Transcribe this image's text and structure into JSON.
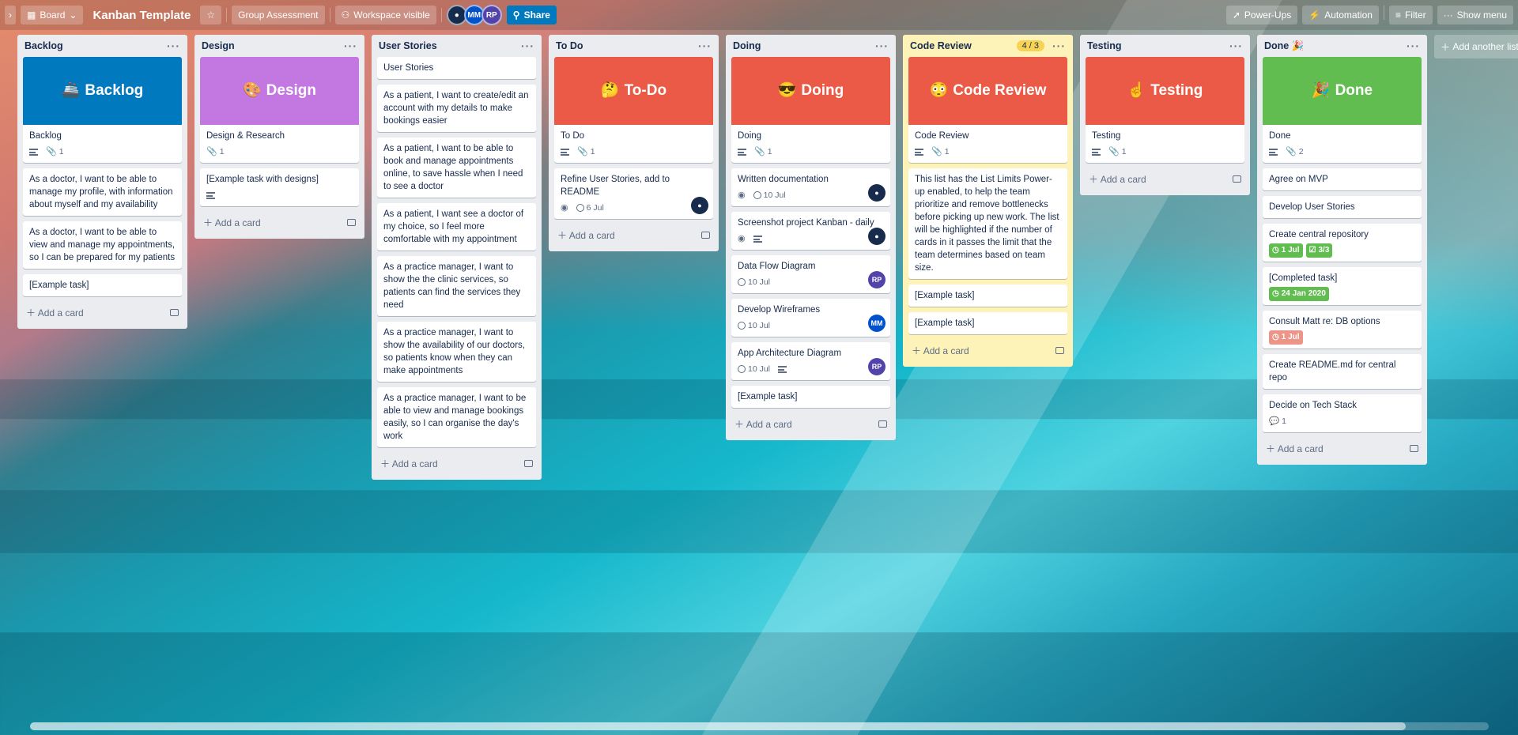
{
  "header": {
    "expand": "›",
    "view": "Board",
    "title": "Kanban Template",
    "group": "Group Assessment",
    "visibility": "Workspace visible",
    "members": [
      {
        "initials": "",
        "color": "#172b4d"
      },
      {
        "initials": "MM",
        "color": "#0052cc"
      },
      {
        "initials": "RP",
        "color": "#5243aa"
      }
    ],
    "share": "Share",
    "powerups": "Power-Ups",
    "automation": "Automation",
    "filter": "Filter",
    "menu": "Show menu"
  },
  "lists": {
    "backlog": {
      "title": "Backlog",
      "cover_title": "Backlog",
      "cover_emoji": "🚢",
      "cover_color": "#0079bf",
      "cards": [
        "Backlog",
        "As a doctor, I want to be able to manage my profile, with information about myself and my availability",
        "As a doctor, I want to be able to view and manage my appointments, so I can be prepared for my patients",
        "[Example task]"
      ],
      "attach": "1"
    },
    "design": {
      "title": "Design",
      "cover_title": "Design",
      "cover_emoji": "🎨",
      "cover_color": "#c377e0",
      "cards": [
        "Design & Research",
        "[Example task with designs]"
      ],
      "attach": "1"
    },
    "stories": {
      "title": "User Stories",
      "cards": [
        "User Stories",
        "As a patient, I want to create/edit an account with my details to make bookings easier",
        "As a patient, I want to be able to book and manage appointments online, to save hassle when I need to see a doctor",
        "As a patient, I want see a doctor of my choice, so I feel more comfortable with my appointment",
        "As a practice manager, I want to show the the clinic services, so patients can find the services they need",
        "As a practice manager, I want to show the availability of our doctors, so patients know when they can make appointments",
        "As a practice manager, I want to be able to view and manage bookings easily, so I can organise the day's work"
      ]
    },
    "todo": {
      "title": "To Do",
      "cover_title": "To-Do",
      "cover_emoji": "🤔",
      "cover_color": "#eb5a46",
      "cards": [
        "To Do",
        "Refine User Stories, add to README"
      ],
      "attach": "1",
      "date": "6 Jul"
    },
    "doing": {
      "title": "Doing",
      "cover_title": "Doing",
      "cover_emoji": "😎",
      "cover_color": "#eb5a46",
      "cards": [
        "Doing",
        "Written documentation",
        "Screenshot project Kanban - daily",
        "Data Flow Diagram",
        "Develop Wireframes",
        "App Architecture Diagram",
        "[Example task]"
      ],
      "attach": "1",
      "date": "10 Jul",
      "mm": "MM",
      "rp": "RP"
    },
    "review": {
      "title": "Code Review",
      "limit": "4 / 3",
      "cover_title": "Code Review",
      "cover_emoji": "😳",
      "cover_color": "#eb5a46",
      "cards": [
        "Code Review",
        "This list has the List Limits Power-up enabled, to help the team prioritize and remove bottlenecks before picking up new work. The list will be highlighted if the number of cards in it passes the limit that the team determines based on team size.",
        "[Example task]",
        "[Example task]"
      ],
      "attach": "1"
    },
    "testing": {
      "title": "Testing",
      "cover_title": "Testing",
      "cover_emoji": "☝️",
      "cover_color": "#eb5a46",
      "cards": [
        "Testing"
      ],
      "attach": "1"
    },
    "done": {
      "title": "Done 🎉",
      "cover_title": "Done",
      "cover_emoji": "🎉",
      "cover_color": "#61bd4f",
      "cards": [
        "Done",
        "Agree on MVP",
        "Develop User Stories",
        "Create central repository",
        "[Completed task]",
        "Consult Matt re: DB options",
        "Create README.md for central repo",
        "Decide on Tech Stack"
      ],
      "attach": "2",
      "date1": "1 Jul",
      "check": "3/3",
      "date2": "24 Jan 2020",
      "date3": "1 Jul",
      "comments": "1"
    }
  },
  "add_card": "Add a card",
  "add_list": "Add another list",
  "colors": {
    "blue": "#0079bf",
    "red": "#eb5a46",
    "green": "#61bd4f",
    "purple": "#c377e0",
    "yellow_list": "#fdf3b9"
  }
}
